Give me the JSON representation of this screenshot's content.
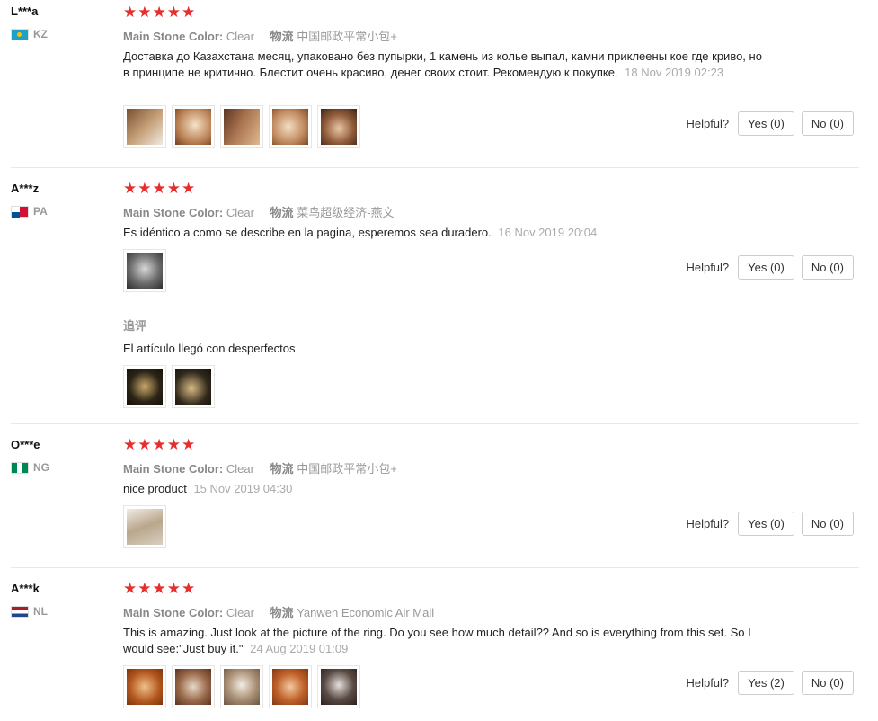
{
  "reviews": [
    {
      "user": "L***a",
      "country": "KZ",
      "stars": "★★★★★",
      "attr_label": "Main Stone Color:",
      "attr_value": "Clear",
      "ship_label": "物流",
      "ship_value": "中国邮政平常小包+",
      "text": "Доставка до Казахстана месяц, упаковано без пупырки, 1 камень из колье выпал, камни приклеены кое где криво, но в принципе не критично. Блестит очень красиво, денег своих стоит. Рекомендую к покупке.",
      "date": "18 Nov 2019 02:23",
      "helpful_label": "Helpful?",
      "yes": "Yes (0)",
      "no": "No (0)"
    },
    {
      "user": "A***z",
      "country": "PA",
      "stars": "★★★★★",
      "attr_label": "Main Stone Color:",
      "attr_value": "Clear",
      "ship_label": "物流",
      "ship_value": "菜鸟超级经济-燕文",
      "text": "Es idéntico a como se describe en la pagina, esperemos sea duradero.",
      "date": "16 Nov 2019 20:04",
      "helpful_label": "Helpful?",
      "yes": "Yes (0)",
      "no": "No (0)",
      "followup_title": "追评",
      "followup_text": "El artículo llegó con desperfectos"
    },
    {
      "user": "O***e",
      "country": "NG",
      "stars": "★★★★★",
      "attr_label": "Main Stone Color:",
      "attr_value": "Clear",
      "ship_label": "物流",
      "ship_value": "中国邮政平常小包+",
      "text": "nice product",
      "date": "15 Nov 2019 04:30",
      "helpful_label": "Helpful?",
      "yes": "Yes (0)",
      "no": "No (0)"
    },
    {
      "user": "A***k",
      "country": "NL",
      "stars": "★★★★★",
      "attr_label": "Main Stone Color:",
      "attr_value": "Clear",
      "ship_label": "物流",
      "ship_value": "Yanwen Economic Air Mail",
      "text": "This is amazing. Just look at the picture of the ring. Do you see how much detail?? And so is everything from this set. So I would see:\"Just buy it.\"",
      "date": "24 Aug 2019 01:09",
      "helpful_label": "Helpful?",
      "yes": "Yes (2)",
      "no": "No (0)"
    }
  ]
}
